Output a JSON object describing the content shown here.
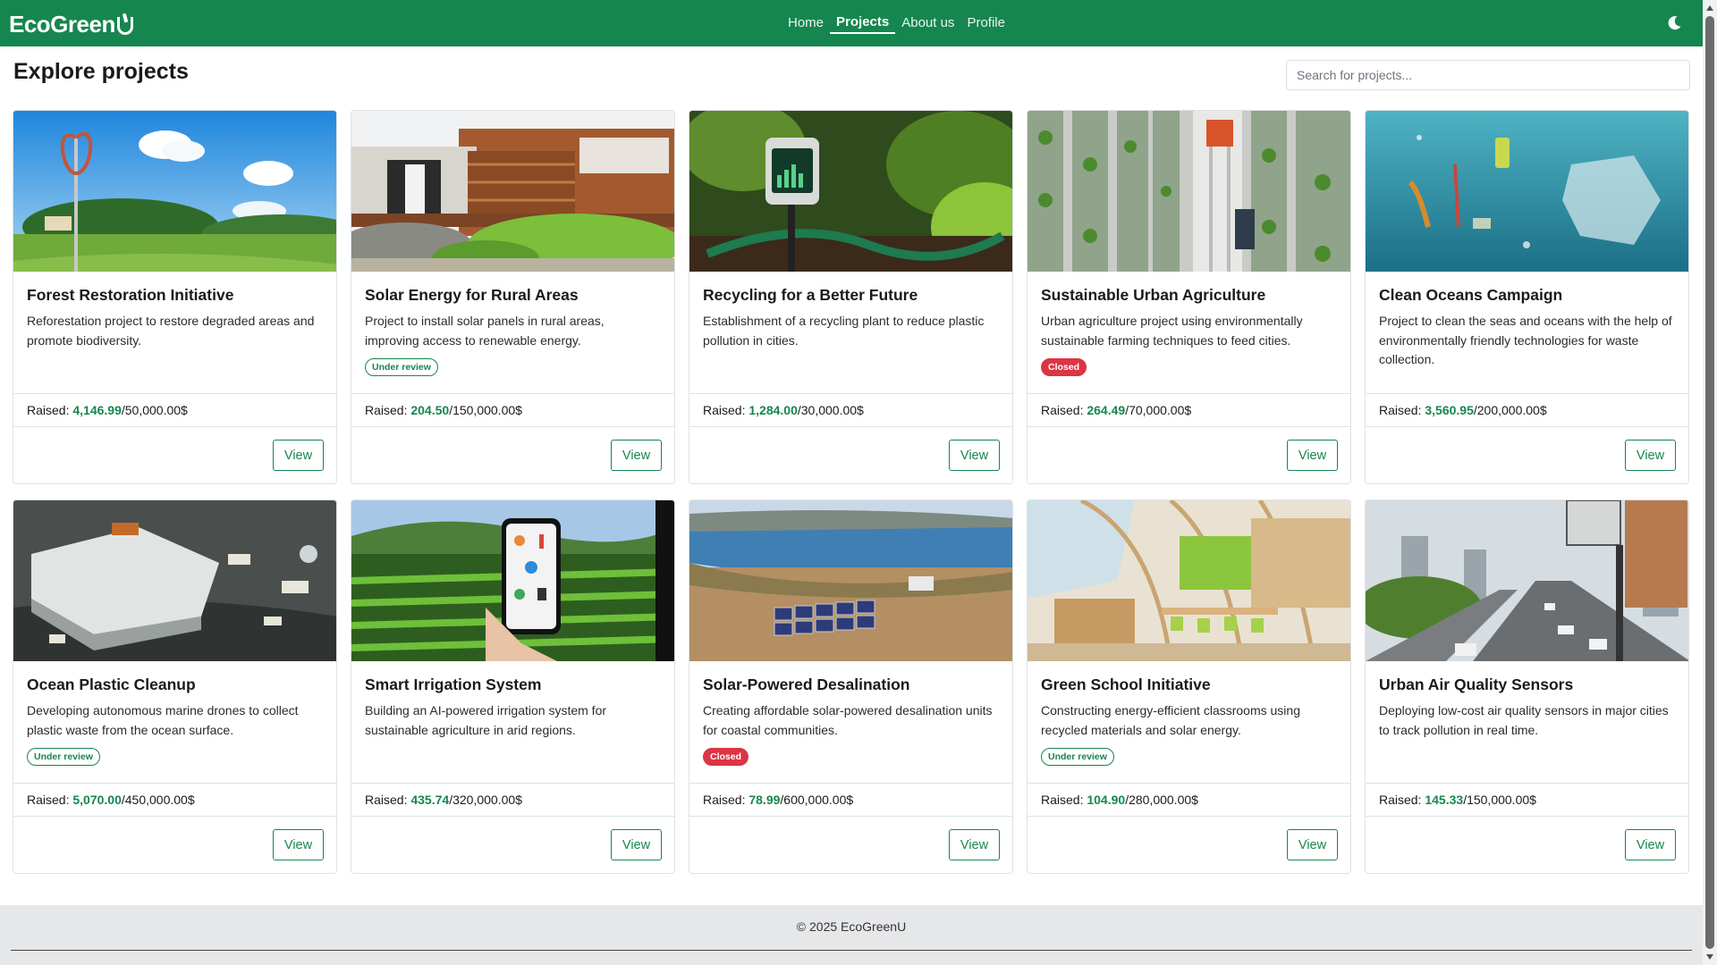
{
  "brand": {
    "name": "EcoGreen"
  },
  "nav": {
    "links": [
      {
        "label": "Home",
        "active": false
      },
      {
        "label": "Projects",
        "active": true
      },
      {
        "label": "About us",
        "active": false
      },
      {
        "label": "Profile",
        "active": false
      }
    ],
    "theme_icon": "moon-icon"
  },
  "page": {
    "title": "Explore projects"
  },
  "search": {
    "placeholder": "Search for projects..."
  },
  "labels": {
    "raised": "Raised: ",
    "view": "View"
  },
  "colors": {
    "primary": "#16864f",
    "closed": "#dc3545",
    "footer_bg": "#e6e7e9"
  },
  "projects": [
    {
      "title": "Forest Restoration Initiative",
      "description": "Reforestation project to restore degraded areas and promote biodiversity.",
      "status": "",
      "raised": "4,146.99",
      "goal": "/50,000.00$",
      "image": "wind-turbine-park"
    },
    {
      "title": "Solar Energy for Rural Areas",
      "description": "Project to install solar panels in rural areas, improving access to renewable energy.",
      "status": "Under review",
      "raised": "204.50",
      "goal": "/150,000.00$",
      "image": "wooden-house"
    },
    {
      "title": "Recycling for a Better Future",
      "description": "Establishment of a recycling plant to reduce plastic pollution in cities.",
      "status": "",
      "raised": "1,284.00",
      "goal": "/30,000.00$",
      "image": "garden-sensor"
    },
    {
      "title": "Sustainable Urban Agriculture",
      "description": "Urban agriculture project using environmentally sustainable farming techniques to feed cities.",
      "status": "Closed",
      "raised": "264.49",
      "goal": "/70,000.00$",
      "image": "vertical-farm"
    },
    {
      "title": "Clean Oceans Campaign",
      "description": "Project to clean the seas and oceans with the help of environmentally friendly technologies for waste collection.",
      "status": "",
      "raised": "3,560.95",
      "goal": "/200,000.00$",
      "image": "ocean-plastic"
    },
    {
      "title": "Ocean Plastic Cleanup",
      "description": "Developing autonomous marine drones to collect plastic waste from the ocean surface.",
      "status": "Under review",
      "raised": "5,070.00",
      "goal": "/450,000.00$",
      "image": "marine-drone"
    },
    {
      "title": "Smart Irrigation System",
      "description": "Building an AI-powered irrigation system for sustainable agriculture in arid regions.",
      "status": "",
      "raised": "435.74",
      "goal": "/320,000.00$",
      "image": "phone-field"
    },
    {
      "title": "Solar-Powered Desalination",
      "description": "Creating affordable solar-powered desalination units for coastal communities.",
      "status": "Closed",
      "raised": "78.99",
      "goal": "/600,000.00$",
      "image": "solar-lake"
    },
    {
      "title": "Green School Initiative",
      "description": "Constructing energy-efficient classrooms using recycled materials and solar energy.",
      "status": "Under review",
      "raised": "104.90",
      "goal": "/280,000.00$",
      "image": "green-classroom"
    },
    {
      "title": "Urban Air Quality Sensors",
      "description": "Deploying low-cost air quality sensors in major cities to track pollution in real time.",
      "status": "",
      "raised": "145.33",
      "goal": "/150,000.00$",
      "image": "city-street-sensor"
    }
  ],
  "footer": {
    "text": "© 2025 EcoGreenU"
  }
}
